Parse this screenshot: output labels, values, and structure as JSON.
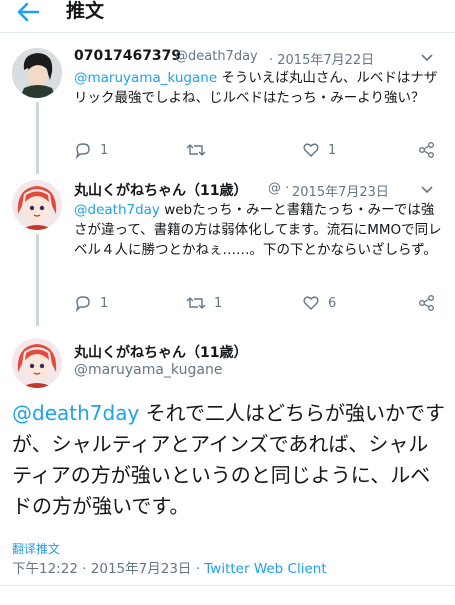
{
  "header": {
    "title": "推文"
  },
  "tweets": [
    {
      "name": "07017467379",
      "handle": "@death7day",
      "date": "· 2015年7月22日",
      "mention": "@maruyama_kugane",
      "text": " そういえば丸山さん、ルベドはナザリック最強でしよね、じルベドはたっち・みーより強い？",
      "replies": "1",
      "retweets": "",
      "likes": "1"
    },
    {
      "name": "丸山くがねちゃん（11歳）",
      "handle": "@ ·",
      "date": "2015年7月23日",
      "mention": "@death7day",
      "text": " webたっち・みーと書籍たっち・みーでは強さが違って、書籍の方は弱体化してます。流石にMMOで同レベル４人に勝つとかねぇ……。下の下とかならいざしらず。",
      "replies": "1",
      "retweets": "1",
      "likes": "6"
    }
  ],
  "main_tweet": {
    "name": "丸山くがねちゃん（11歳）",
    "handle": "@maruyama_kugane",
    "mention": "@death7day",
    "text": " それで二人はどちらが強いかですが、シャルティアとアインズであれば、シャルティアの方が強いというのと同じように、ルベドの方が強いです。",
    "translate": "翻译推文",
    "timestamp": "下午12:22 · 2015年7月23日 · ",
    "client": "Twitter Web Client"
  },
  "colors": {
    "accent": "#1da1f2",
    "muted": "#657786",
    "text": "#14171a"
  }
}
